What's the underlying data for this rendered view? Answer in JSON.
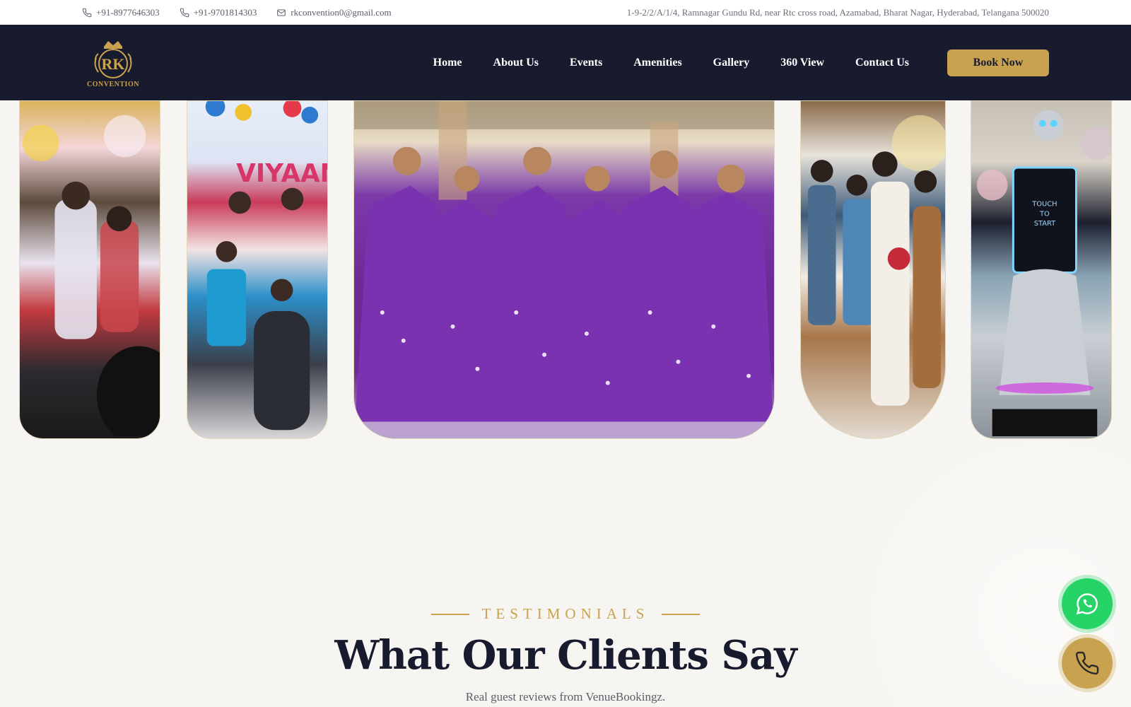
{
  "topbar": {
    "phone1": "+91-8977646303",
    "phone2": "+91-9701814303",
    "email": "rkconvention0@gmail.com",
    "address": "1-9-2/2/A/1/4, Ramnagar Gundu Rd, near Rtc cross road, Azamabad, Bharat Nagar, Hyderabad, Telangana 500020"
  },
  "logo": {
    "monogram": "RK",
    "subtitle": "CONVENTION"
  },
  "nav": {
    "items": [
      {
        "label": "Home"
      },
      {
        "label": "About Us"
      },
      {
        "label": "Events"
      },
      {
        "label": "Amenities"
      },
      {
        "label": "Gallery"
      },
      {
        "label": "360 View"
      },
      {
        "label": "Contact Us"
      }
    ],
    "cta": "Book Now"
  },
  "gallery": {
    "photos": [
      "wedding-stage-photo",
      "birthday-family-photo",
      "dancers-group-photo",
      "wedding-couple-photo",
      "robot-photo-booth-photo"
    ]
  },
  "testimonials": {
    "eyebrow": "TESTIMONIALS",
    "title": "What Our Clients Say",
    "subtitle": "Real guest reviews from VenueBookingz."
  },
  "floating": {
    "whatsapp_icon": "whatsapp-icon",
    "phone_icon": "phone-icon"
  },
  "colors": {
    "navy": "#181b2e",
    "gold": "#c9a24f",
    "whatsapp_green": "#25d366",
    "page_bg": "#f7f5f1"
  }
}
